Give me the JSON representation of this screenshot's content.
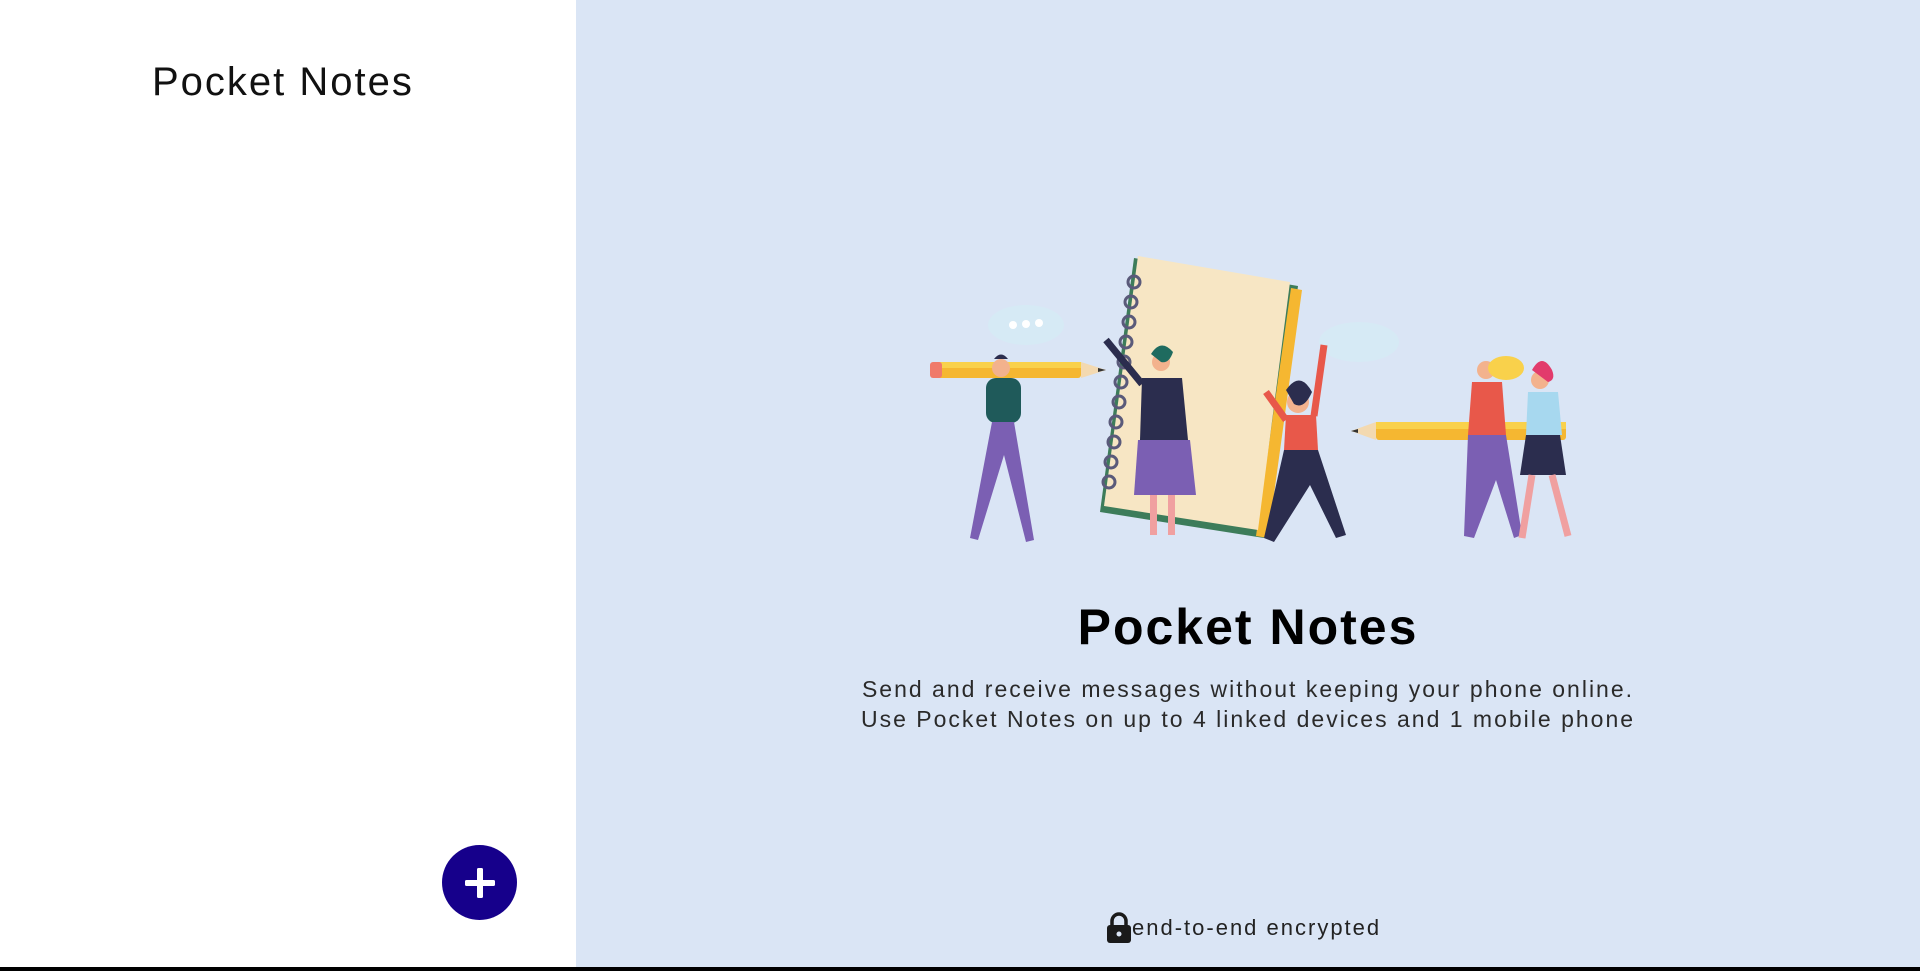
{
  "sidebar": {
    "title": "Pocket Notes"
  },
  "add_button": {
    "icon": "plus-icon",
    "color": "#16008b"
  },
  "main": {
    "title": "Pocket Notes",
    "description_line1": "Send and receive messages without keeping your phone online.",
    "description_line2": "Use Pocket Notes on up to 4 linked devices and 1 mobile phone",
    "background": "#dae5f5"
  },
  "footer": {
    "icon": "lock-icon",
    "text": "end-to-end encrypted"
  }
}
